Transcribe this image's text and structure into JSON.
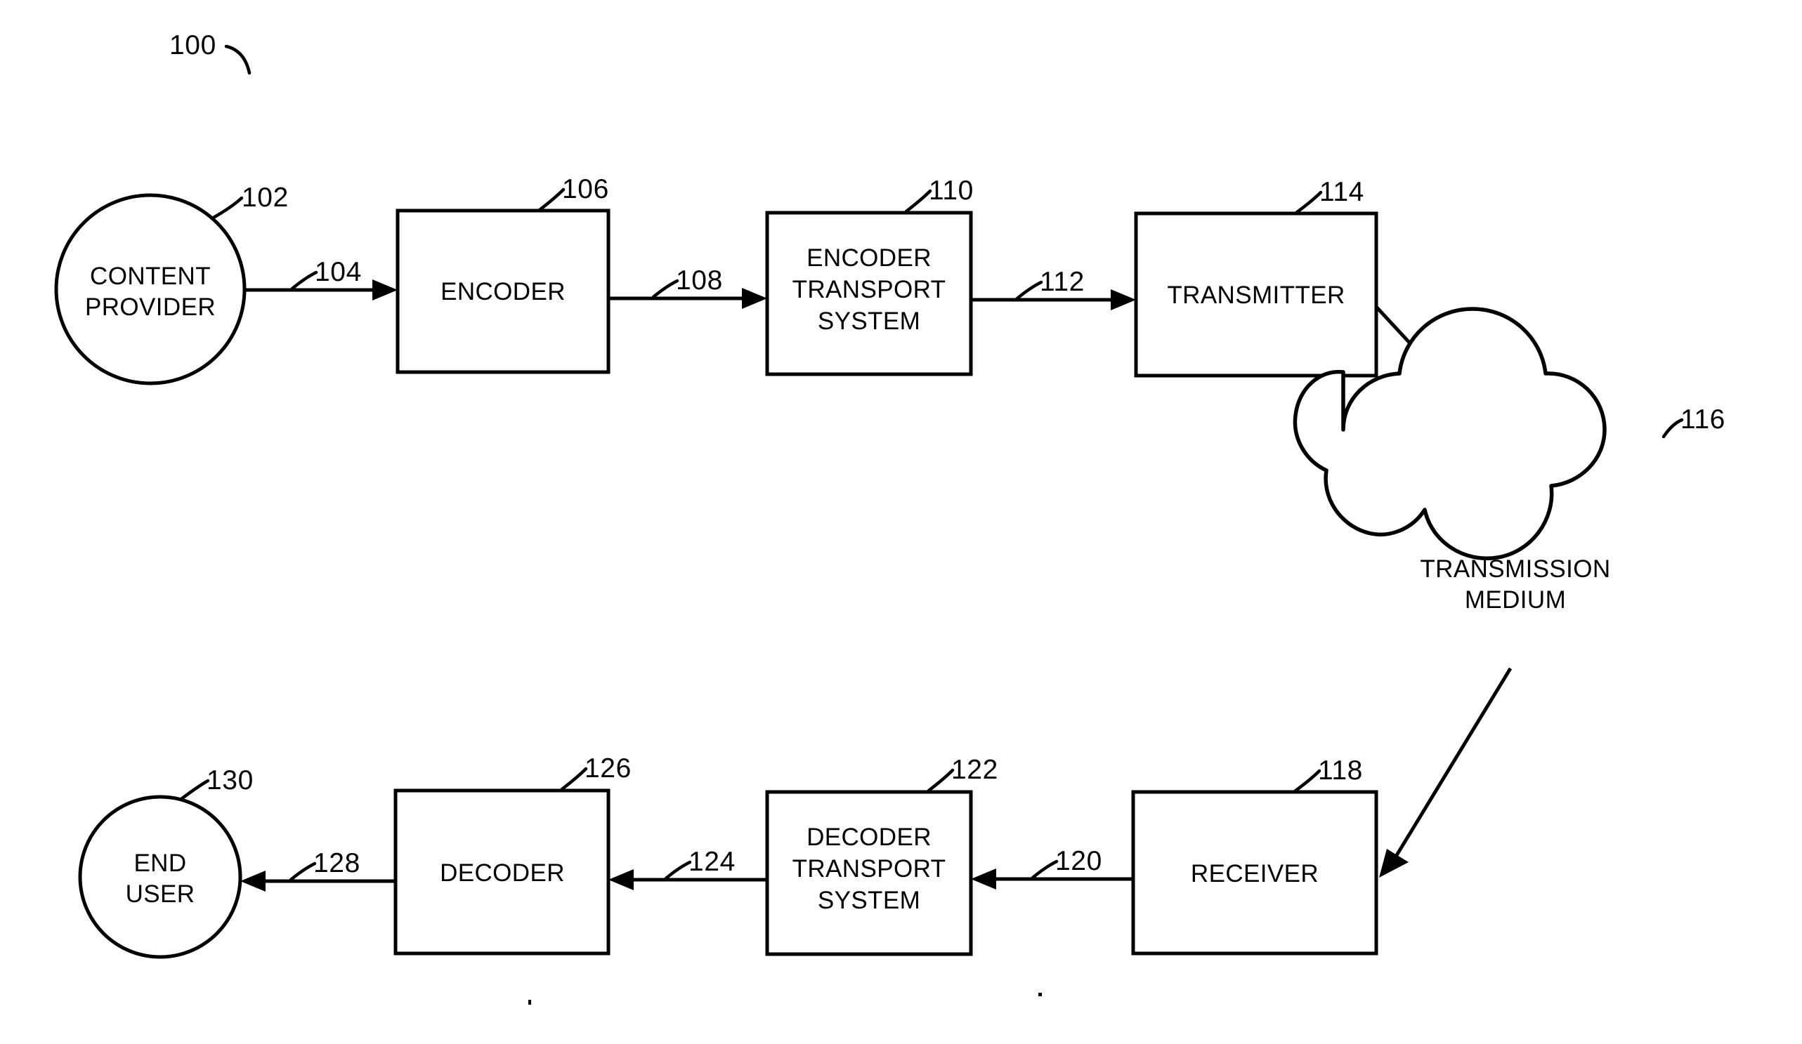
{
  "figure": {
    "figure_number": "100",
    "background_color": "#ffffff",
    "line_color": "#000000"
  },
  "nodes": {
    "content_provider": {
      "label_line1": "CONTENT",
      "label_line2": "PROVIDER",
      "ref": "102",
      "shape": "circle"
    },
    "encoder": {
      "label_line1": "ENCODER",
      "ref": "106",
      "shape": "rectangle"
    },
    "encoder_transport_system": {
      "label_line1": "ENCODER",
      "label_line2": "TRANSPORT",
      "label_line3": "SYSTEM",
      "ref": "110",
      "shape": "rectangle"
    },
    "transmitter": {
      "label_line1": "TRANSMITTER",
      "ref": "114",
      "shape": "rectangle"
    },
    "transmission_medium": {
      "label_line1": "TRANSMISSION",
      "label_line2": "MEDIUM",
      "ref": "116",
      "shape": "cloud"
    },
    "receiver": {
      "label_line1": "RECEIVER",
      "ref": "118",
      "shape": "rectangle"
    },
    "decoder_transport_system": {
      "label_line1": "DECODER",
      "label_line2": "TRANSPORT",
      "label_line3": "SYSTEM",
      "ref": "122",
      "shape": "rectangle"
    },
    "decoder": {
      "label_line1": "DECODER",
      "ref": "126",
      "shape": "rectangle"
    },
    "end_user": {
      "label_line1": "END",
      "label_line2": "USER",
      "ref": "130",
      "shape": "circle"
    }
  },
  "connections": {
    "provider_to_encoder": {
      "ref": "104",
      "direction": "right"
    },
    "encoder_to_ets": {
      "ref": "108",
      "direction": "right"
    },
    "ets_to_transmitter": {
      "ref": "112",
      "direction": "right"
    },
    "transmitter_to_medium": {
      "ref": "",
      "direction": "diagonal-down-right"
    },
    "medium_to_receiver": {
      "ref": "",
      "direction": "diagonal-down-left"
    },
    "receiver_to_dts": {
      "ref": "120",
      "direction": "left"
    },
    "dts_to_decoder": {
      "ref": "124",
      "direction": "left"
    },
    "decoder_to_end_user": {
      "ref": "128",
      "direction": "left"
    }
  }
}
